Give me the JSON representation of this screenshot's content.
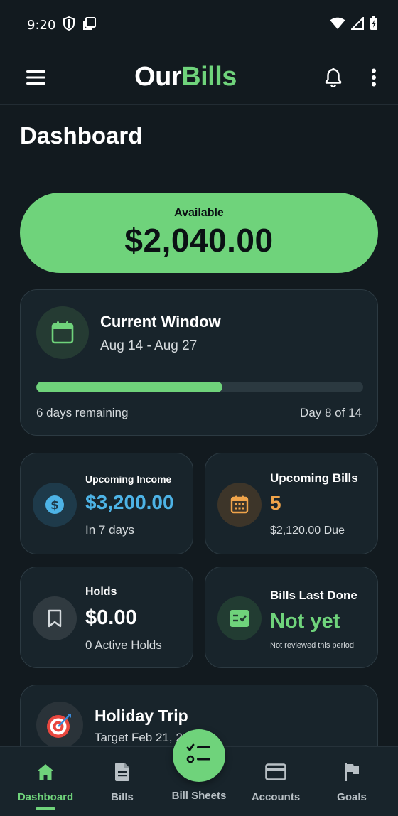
{
  "status_bar": {
    "time": "9:20",
    "icons": [
      "shield-icon",
      "screen-icon",
      "wifi-icon",
      "signal-icon",
      "battery-icon"
    ]
  },
  "app_bar": {
    "brand_part1": "Our",
    "brand_part2": "Bills",
    "icons": [
      "menu-icon",
      "bell-icon",
      "more-vertical-icon"
    ]
  },
  "page": {
    "title": "Dashboard"
  },
  "available": {
    "label": "Available",
    "amount": "$2,040.00"
  },
  "current_window": {
    "title": "Current Window",
    "range": "Aug 14 - Aug 27",
    "progress_fraction": 0.57,
    "remaining": "6 days remaining",
    "day": "Day 8 of 14",
    "icon": "calendar-icon"
  },
  "tiles": {
    "income": {
      "title": "Upcoming Income",
      "value": "$3,200.00",
      "sub": "In 7 days",
      "icon": "dollar-icon"
    },
    "bills": {
      "title": "Upcoming Bills",
      "value": "5",
      "sub": "$2,120.00 Due",
      "icon": "calendar-grid-icon"
    },
    "holds": {
      "title": "Holds",
      "value": "$0.00",
      "sub": "0 Active Holds",
      "icon": "bookmark-icon"
    },
    "last_done": {
      "title": "Bills Last Done",
      "value": "Not yet",
      "sub": "Not reviewed this period",
      "icon": "checklist-icon"
    }
  },
  "goal": {
    "title": "Holiday Trip",
    "target": "Target Feb 21, 2",
    "icon": "target-icon"
  },
  "nav": {
    "dashboard": "Dashboard",
    "bills": "Bills",
    "bill_sheets": "Bill Sheets",
    "accounts": "Accounts",
    "goals": "Goals"
  },
  "colors": {
    "background": "#121a1f",
    "card": "#18242b",
    "accent_green": "#6fd37b",
    "income_blue": "#4db3e6",
    "bills_orange": "#f0a44a"
  }
}
